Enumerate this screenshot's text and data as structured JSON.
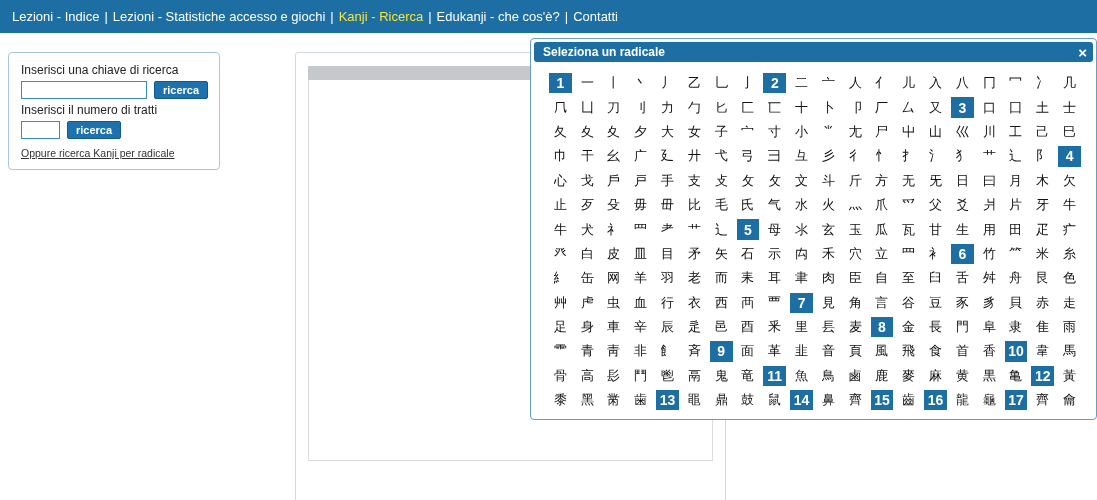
{
  "nav": {
    "separator": "|",
    "items": [
      {
        "label": "Lezioni - Indice",
        "selected": false
      },
      {
        "label": "Lezioni - Statistiche accesso e giochi",
        "selected": false
      },
      {
        "label": "Kanji - Ricerca",
        "selected": true
      },
      {
        "label": "Edukanji - che cos'è?",
        "selected": false
      },
      {
        "label": "Contatti",
        "selected": false
      }
    ]
  },
  "search_box": {
    "key_label": "Inserisci una chiave di ricerca",
    "key_button": "ricerca",
    "strokes_label": "Inserisci il numero di tratti",
    "strokes_button": "ricerca",
    "radical_link": "Oppure ricerca Kanji per radicale"
  },
  "radical_popup": {
    "title": "Seleziona un radicale",
    "close": "×",
    "rows": [
      [
        {
          "kind": "count",
          "text": "1"
        },
        {
          "kind": "radical",
          "text": "一"
        },
        {
          "kind": "radical",
          "text": "丨"
        },
        {
          "kind": "radical",
          "text": "丶"
        },
        {
          "kind": "radical",
          "text": "丿"
        },
        {
          "kind": "radical",
          "text": "乙"
        },
        {
          "kind": "radical",
          "text": "乚"
        },
        {
          "kind": "radical",
          "text": "亅"
        },
        {
          "kind": "count",
          "text": "2"
        },
        {
          "kind": "radical",
          "text": "二"
        },
        {
          "kind": "radical",
          "text": "亠"
        },
        {
          "kind": "radical",
          "text": "人"
        },
        {
          "kind": "radical",
          "text": "亻"
        },
        {
          "kind": "radical",
          "text": "儿"
        },
        {
          "kind": "radical",
          "text": "入"
        },
        {
          "kind": "radical",
          "text": "八"
        },
        {
          "kind": "radical",
          "text": "冂"
        },
        {
          "kind": "radical",
          "text": "冖"
        },
        {
          "kind": "radical",
          "text": "冫"
        },
        {
          "kind": "radical",
          "text": "几"
        }
      ],
      [
        {
          "kind": "radical",
          "text": "𠘨"
        },
        {
          "kind": "radical",
          "text": "凵"
        },
        {
          "kind": "radical",
          "text": "刀"
        },
        {
          "kind": "radical",
          "text": "刂"
        },
        {
          "kind": "radical",
          "text": "力"
        },
        {
          "kind": "radical",
          "text": "勹"
        },
        {
          "kind": "radical",
          "text": "匕"
        },
        {
          "kind": "radical",
          "text": "匚"
        },
        {
          "kind": "radical",
          "text": "匸"
        },
        {
          "kind": "radical",
          "text": "十"
        },
        {
          "kind": "radical",
          "text": "卜"
        },
        {
          "kind": "radical",
          "text": "卩"
        },
        {
          "kind": "radical",
          "text": "厂"
        },
        {
          "kind": "radical",
          "text": "厶"
        },
        {
          "kind": "radical",
          "text": "又"
        },
        {
          "kind": "count",
          "text": "3"
        },
        {
          "kind": "radical",
          "text": "口"
        },
        {
          "kind": "radical",
          "text": "囗"
        },
        {
          "kind": "radical",
          "text": "土"
        },
        {
          "kind": "radical",
          "text": "士"
        }
      ],
      [
        {
          "kind": "radical",
          "text": "夂"
        },
        {
          "kind": "radical",
          "text": "夊"
        },
        {
          "kind": "radical",
          "text": "夊"
        },
        {
          "kind": "radical",
          "text": "夕"
        },
        {
          "kind": "radical",
          "text": "大"
        },
        {
          "kind": "radical",
          "text": "女"
        },
        {
          "kind": "radical",
          "text": "子"
        },
        {
          "kind": "radical",
          "text": "宀"
        },
        {
          "kind": "radical",
          "text": "寸"
        },
        {
          "kind": "radical",
          "text": "小"
        },
        {
          "kind": "radical",
          "text": "⺌"
        },
        {
          "kind": "radical",
          "text": "尢"
        },
        {
          "kind": "radical",
          "text": "尸"
        },
        {
          "kind": "radical",
          "text": "屮"
        },
        {
          "kind": "radical",
          "text": "山"
        },
        {
          "kind": "radical",
          "text": "巛"
        },
        {
          "kind": "radical",
          "text": "川"
        },
        {
          "kind": "radical",
          "text": "工"
        },
        {
          "kind": "radical",
          "text": "己"
        },
        {
          "kind": "radical",
          "text": "巳"
        }
      ],
      [
        {
          "kind": "radical",
          "text": "巾"
        },
        {
          "kind": "radical",
          "text": "干"
        },
        {
          "kind": "radical",
          "text": "幺"
        },
        {
          "kind": "radical",
          "text": "广"
        },
        {
          "kind": "radical",
          "text": "廴"
        },
        {
          "kind": "radical",
          "text": "廾"
        },
        {
          "kind": "radical",
          "text": "弋"
        },
        {
          "kind": "radical",
          "text": "弓"
        },
        {
          "kind": "radical",
          "text": "彐"
        },
        {
          "kind": "radical",
          "text": "彑"
        },
        {
          "kind": "radical",
          "text": "彡"
        },
        {
          "kind": "radical",
          "text": "彳"
        },
        {
          "kind": "radical",
          "text": "忄"
        },
        {
          "kind": "radical",
          "text": "扌"
        },
        {
          "kind": "radical",
          "text": "氵"
        },
        {
          "kind": "radical",
          "text": "犭"
        },
        {
          "kind": "radical",
          "text": "艹"
        },
        {
          "kind": "radical",
          "text": "辶"
        },
        {
          "kind": "radical",
          "text": "阝"
        },
        {
          "kind": "count",
          "text": "4"
        }
      ],
      [
        {
          "kind": "radical",
          "text": "心"
        },
        {
          "kind": "radical",
          "text": "戈"
        },
        {
          "kind": "radical",
          "text": "戶"
        },
        {
          "kind": "radical",
          "text": "戸"
        },
        {
          "kind": "radical",
          "text": "手"
        },
        {
          "kind": "radical",
          "text": "支"
        },
        {
          "kind": "radical",
          "text": "攴"
        },
        {
          "kind": "radical",
          "text": "攵"
        },
        {
          "kind": "radical",
          "text": "攵"
        },
        {
          "kind": "radical",
          "text": "文"
        },
        {
          "kind": "radical",
          "text": "斗"
        },
        {
          "kind": "radical",
          "text": "斤"
        },
        {
          "kind": "radical",
          "text": "方"
        },
        {
          "kind": "radical",
          "text": "无"
        },
        {
          "kind": "radical",
          "text": "旡"
        },
        {
          "kind": "radical",
          "text": "日"
        },
        {
          "kind": "radical",
          "text": "曰"
        },
        {
          "kind": "radical",
          "text": "月"
        },
        {
          "kind": "radical",
          "text": "木"
        },
        {
          "kind": "radical",
          "text": "欠"
        }
      ],
      [
        {
          "kind": "radical",
          "text": "止"
        },
        {
          "kind": "radical",
          "text": "歹"
        },
        {
          "kind": "radical",
          "text": "殳"
        },
        {
          "kind": "radical",
          "text": "毋"
        },
        {
          "kind": "radical",
          "text": "毌"
        },
        {
          "kind": "radical",
          "text": "比"
        },
        {
          "kind": "radical",
          "text": "毛"
        },
        {
          "kind": "radical",
          "text": "氏"
        },
        {
          "kind": "radical",
          "text": "气"
        },
        {
          "kind": "radical",
          "text": "水"
        },
        {
          "kind": "radical",
          "text": "火"
        },
        {
          "kind": "radical",
          "text": "灬"
        },
        {
          "kind": "radical",
          "text": "爪"
        },
        {
          "kind": "radical",
          "text": "爫"
        },
        {
          "kind": "radical",
          "text": "父"
        },
        {
          "kind": "radical",
          "text": "爻"
        },
        {
          "kind": "radical",
          "text": "爿"
        },
        {
          "kind": "radical",
          "text": "片"
        },
        {
          "kind": "radical",
          "text": "牙"
        },
        {
          "kind": "radical",
          "text": "牛"
        }
      ],
      [
        {
          "kind": "radical",
          "text": "牛"
        },
        {
          "kind": "radical",
          "text": "犬"
        },
        {
          "kind": "radical",
          "text": "礻"
        },
        {
          "kind": "radical",
          "text": "罒"
        },
        {
          "kind": "radical",
          "text": "耂"
        },
        {
          "kind": "radical",
          "text": "艹"
        },
        {
          "kind": "radical",
          "text": "辶"
        },
        {
          "kind": "count",
          "text": "5"
        },
        {
          "kind": "radical",
          "text": "母"
        },
        {
          "kind": "radical",
          "text": "氺"
        },
        {
          "kind": "radical",
          "text": "玄"
        },
        {
          "kind": "radical",
          "text": "玉"
        },
        {
          "kind": "radical",
          "text": "瓜"
        },
        {
          "kind": "radical",
          "text": "瓦"
        },
        {
          "kind": "radical",
          "text": "甘"
        },
        {
          "kind": "radical",
          "text": "生"
        },
        {
          "kind": "radical",
          "text": "用"
        },
        {
          "kind": "radical",
          "text": "田"
        },
        {
          "kind": "radical",
          "text": "疋"
        },
        {
          "kind": "radical",
          "text": "疒"
        }
      ],
      [
        {
          "kind": "radical",
          "text": "癶"
        },
        {
          "kind": "radical",
          "text": "白"
        },
        {
          "kind": "radical",
          "text": "皮"
        },
        {
          "kind": "radical",
          "text": "皿"
        },
        {
          "kind": "radical",
          "text": "目"
        },
        {
          "kind": "radical",
          "text": "矛"
        },
        {
          "kind": "radical",
          "text": "矢"
        },
        {
          "kind": "radical",
          "text": "石"
        },
        {
          "kind": "radical",
          "text": "示"
        },
        {
          "kind": "radical",
          "text": "禸"
        },
        {
          "kind": "radical",
          "text": "禾"
        },
        {
          "kind": "radical",
          "text": "穴"
        },
        {
          "kind": "radical",
          "text": "立"
        },
        {
          "kind": "radical",
          "text": "罒"
        },
        {
          "kind": "radical",
          "text": "衤"
        },
        {
          "kind": "count",
          "text": "6"
        },
        {
          "kind": "radical",
          "text": "竹"
        },
        {
          "kind": "radical",
          "text": "⺮"
        },
        {
          "kind": "radical",
          "text": "米"
        },
        {
          "kind": "radical",
          "text": "糸"
        }
      ],
      [
        {
          "kind": "radical",
          "text": "糹"
        },
        {
          "kind": "radical",
          "text": "缶"
        },
        {
          "kind": "radical",
          "text": "网"
        },
        {
          "kind": "radical",
          "text": "羊"
        },
        {
          "kind": "radical",
          "text": "羽"
        },
        {
          "kind": "radical",
          "text": "老"
        },
        {
          "kind": "radical",
          "text": "而"
        },
        {
          "kind": "radical",
          "text": "耒"
        },
        {
          "kind": "radical",
          "text": "耳"
        },
        {
          "kind": "radical",
          "text": "聿"
        },
        {
          "kind": "radical",
          "text": "肉"
        },
        {
          "kind": "radical",
          "text": "臣"
        },
        {
          "kind": "radical",
          "text": "自"
        },
        {
          "kind": "radical",
          "text": "至"
        },
        {
          "kind": "radical",
          "text": "臼"
        },
        {
          "kind": "radical",
          "text": "舌"
        },
        {
          "kind": "radical",
          "text": "舛"
        },
        {
          "kind": "radical",
          "text": "舟"
        },
        {
          "kind": "radical",
          "text": "艮"
        },
        {
          "kind": "radical",
          "text": "色"
        }
      ],
      [
        {
          "kind": "radical",
          "text": "艸"
        },
        {
          "kind": "radical",
          "text": "虍"
        },
        {
          "kind": "radical",
          "text": "虫"
        },
        {
          "kind": "radical",
          "text": "血"
        },
        {
          "kind": "radical",
          "text": "行"
        },
        {
          "kind": "radical",
          "text": "衣"
        },
        {
          "kind": "radical",
          "text": "西"
        },
        {
          "kind": "radical",
          "text": "襾"
        },
        {
          "kind": "radical",
          "text": "覀"
        },
        {
          "kind": "count",
          "text": "7"
        },
        {
          "kind": "radical",
          "text": "見"
        },
        {
          "kind": "radical",
          "text": "角"
        },
        {
          "kind": "radical",
          "text": "言"
        },
        {
          "kind": "radical",
          "text": "谷"
        },
        {
          "kind": "radical",
          "text": "豆"
        },
        {
          "kind": "radical",
          "text": "豕"
        },
        {
          "kind": "radical",
          "text": "豸"
        },
        {
          "kind": "radical",
          "text": "貝"
        },
        {
          "kind": "radical",
          "text": "赤"
        },
        {
          "kind": "radical",
          "text": "走"
        }
      ],
      [
        {
          "kind": "radical",
          "text": "足"
        },
        {
          "kind": "radical",
          "text": "身"
        },
        {
          "kind": "radical",
          "text": "車"
        },
        {
          "kind": "radical",
          "text": "辛"
        },
        {
          "kind": "radical",
          "text": "辰"
        },
        {
          "kind": "radical",
          "text": "辵"
        },
        {
          "kind": "radical",
          "text": "邑"
        },
        {
          "kind": "radical",
          "text": "酉"
        },
        {
          "kind": "radical",
          "text": "釆"
        },
        {
          "kind": "radical",
          "text": "里"
        },
        {
          "kind": "radical",
          "text": "镸"
        },
        {
          "kind": "radical",
          "text": "麦"
        },
        {
          "kind": "count",
          "text": "8"
        },
        {
          "kind": "radical",
          "text": "金"
        },
        {
          "kind": "radical",
          "text": "長"
        },
        {
          "kind": "radical",
          "text": "門"
        },
        {
          "kind": "radical",
          "text": "阜"
        },
        {
          "kind": "radical",
          "text": "隶"
        },
        {
          "kind": "radical",
          "text": "隹"
        },
        {
          "kind": "radical",
          "text": "雨"
        }
      ],
      [
        {
          "kind": "radical",
          "text": "⻗"
        },
        {
          "kind": "radical",
          "text": "青"
        },
        {
          "kind": "radical",
          "text": "靑"
        },
        {
          "kind": "radical",
          "text": "非"
        },
        {
          "kind": "radical",
          "text": "飠"
        },
        {
          "kind": "radical",
          "text": "斉"
        },
        {
          "kind": "count",
          "text": "9"
        },
        {
          "kind": "radical",
          "text": "面"
        },
        {
          "kind": "radical",
          "text": "革"
        },
        {
          "kind": "radical",
          "text": "韭"
        },
        {
          "kind": "radical",
          "text": "音"
        },
        {
          "kind": "radical",
          "text": "頁"
        },
        {
          "kind": "radical",
          "text": "風"
        },
        {
          "kind": "radical",
          "text": "飛"
        },
        {
          "kind": "radical",
          "text": "食"
        },
        {
          "kind": "radical",
          "text": "首"
        },
        {
          "kind": "radical",
          "text": "香"
        },
        {
          "kind": "count",
          "text": "10"
        },
        {
          "kind": "radical",
          "text": "韋"
        },
        {
          "kind": "radical",
          "text": "馬"
        }
      ],
      [
        {
          "kind": "radical",
          "text": "骨"
        },
        {
          "kind": "radical",
          "text": "高"
        },
        {
          "kind": "radical",
          "text": "髟"
        },
        {
          "kind": "radical",
          "text": "鬥"
        },
        {
          "kind": "radical",
          "text": "鬯"
        },
        {
          "kind": "radical",
          "text": "鬲"
        },
        {
          "kind": "radical",
          "text": "鬼"
        },
        {
          "kind": "radical",
          "text": "竜"
        },
        {
          "kind": "count",
          "text": "11"
        },
        {
          "kind": "radical",
          "text": "魚"
        },
        {
          "kind": "radical",
          "text": "鳥"
        },
        {
          "kind": "radical",
          "text": "鹵"
        },
        {
          "kind": "radical",
          "text": "鹿"
        },
        {
          "kind": "radical",
          "text": "麥"
        },
        {
          "kind": "radical",
          "text": "麻"
        },
        {
          "kind": "radical",
          "text": "黄"
        },
        {
          "kind": "radical",
          "text": "黒"
        },
        {
          "kind": "radical",
          "text": "亀"
        },
        {
          "kind": "count",
          "text": "12"
        },
        {
          "kind": "radical",
          "text": "黃"
        }
      ],
      [
        {
          "kind": "radical",
          "text": "黍"
        },
        {
          "kind": "radical",
          "text": "黑"
        },
        {
          "kind": "radical",
          "text": "黹"
        },
        {
          "kind": "radical",
          "text": "歯"
        },
        {
          "kind": "count",
          "text": "13"
        },
        {
          "kind": "radical",
          "text": "黽"
        },
        {
          "kind": "radical",
          "text": "鼎"
        },
        {
          "kind": "radical",
          "text": "鼓"
        },
        {
          "kind": "radical",
          "text": "鼠"
        },
        {
          "kind": "count",
          "text": "14"
        },
        {
          "kind": "radical",
          "text": "鼻"
        },
        {
          "kind": "radical",
          "text": "齊"
        },
        {
          "kind": "count",
          "text": "15"
        },
        {
          "kind": "radical",
          "text": "齒"
        },
        {
          "kind": "count",
          "text": "16"
        },
        {
          "kind": "radical",
          "text": "龍"
        },
        {
          "kind": "radical",
          "text": "龜"
        },
        {
          "kind": "count",
          "text": "17"
        },
        {
          "kind": "radical",
          "text": "齊"
        },
        {
          "kind": "radical",
          "text": "龠"
        }
      ]
    ]
  }
}
